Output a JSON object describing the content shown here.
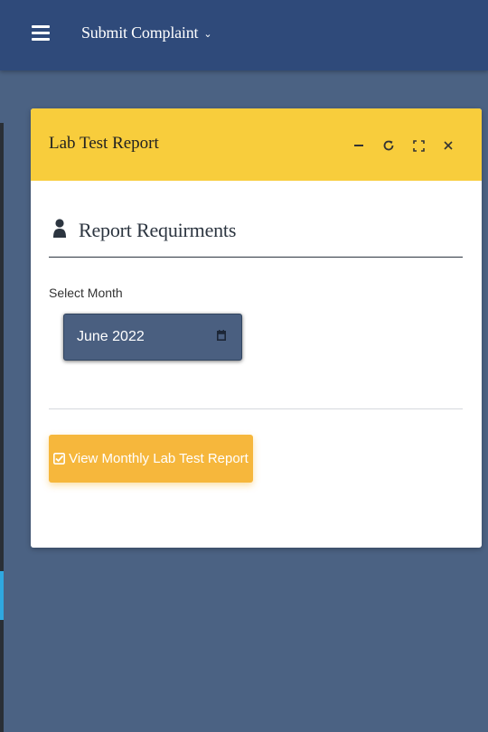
{
  "topbar": {
    "menu_icon": "hamburger-menu-icon",
    "title": "Submit Complaint",
    "dropdown_icon": "chevron-down-icon"
  },
  "card": {
    "title": "Lab Test Report",
    "header_color": "#f8cd3c",
    "tools": [
      {
        "name": "minimize-icon",
        "glyph": "−"
      },
      {
        "name": "refresh-icon",
        "glyph": "⟳"
      },
      {
        "name": "expand-icon",
        "glyph": "⛶"
      },
      {
        "name": "close-icon",
        "glyph": "×"
      }
    ]
  },
  "section": {
    "icon": "user-icon",
    "heading": "Report Requirments"
  },
  "form": {
    "month_label": "Select Month",
    "month_value": "June 2022",
    "calendar_icon": "calendar-icon"
  },
  "action": {
    "button_label": "View Monthly Lab Test Report",
    "button_icon": "check-square-icon",
    "button_color": "#f6b73c"
  },
  "colors": {
    "topbar": "#2f4a7a",
    "background": "#4b6283",
    "input": "#4a5f80"
  }
}
